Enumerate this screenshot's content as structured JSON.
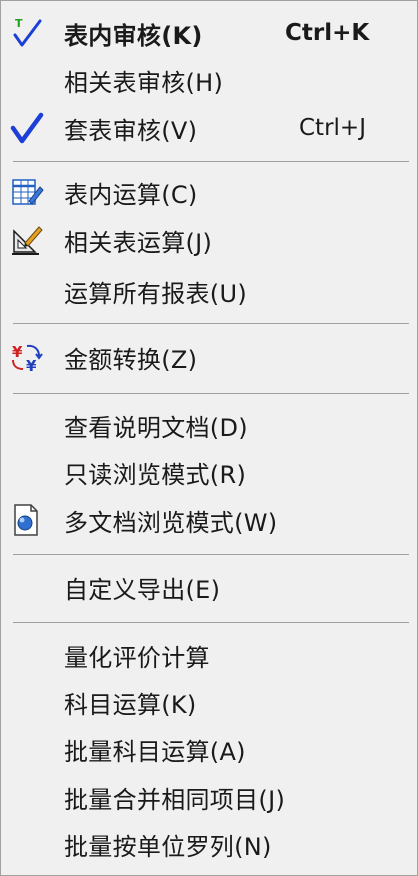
{
  "menu": {
    "items": [
      {
        "label": "表内审核(K)",
        "shortcut": "Ctrl+K",
        "icon": "check-t-icon"
      },
      {
        "label": "相关表审核(H)",
        "shortcut": "",
        "icon": ""
      },
      {
        "label": "套表审核(V)",
        "shortcut": "Ctrl+J",
        "icon": "check-icon"
      },
      {
        "label": "表内运算(C)",
        "shortcut": "",
        "icon": "table-edit-icon"
      },
      {
        "label": "相关表运算(J)",
        "shortcut": "",
        "icon": "ruler-pencil-icon"
      },
      {
        "label": "运算所有报表(U)",
        "shortcut": "",
        "icon": ""
      },
      {
        "label": "金额转换(Z)",
        "shortcut": "",
        "icon": "currency-convert-icon"
      },
      {
        "label": "查看说明文档(D)",
        "shortcut": "",
        "icon": ""
      },
      {
        "label": "只读浏览模式(R)",
        "shortcut": "",
        "icon": ""
      },
      {
        "label": "多文档浏览模式(W)",
        "shortcut": "",
        "icon": "multi-document-icon"
      },
      {
        "label": "自定义导出(E)",
        "shortcut": "",
        "icon": ""
      },
      {
        "label": "量化评价计算",
        "shortcut": "",
        "icon": ""
      },
      {
        "label": "科目运算(K)",
        "shortcut": "",
        "icon": ""
      },
      {
        "label": "批量科目运算(A)",
        "shortcut": "",
        "icon": ""
      },
      {
        "label": "批量合并相同项目(J)",
        "shortcut": "",
        "icon": ""
      },
      {
        "label": "批量按单位罗列(N)",
        "shortcut": "",
        "icon": ""
      }
    ]
  },
  "colors": {
    "check_blue": "#1c3fd8",
    "menu_bg": "#f0f0f0",
    "separator": "#a0a0a0",
    "text": "#1a1a1a"
  }
}
